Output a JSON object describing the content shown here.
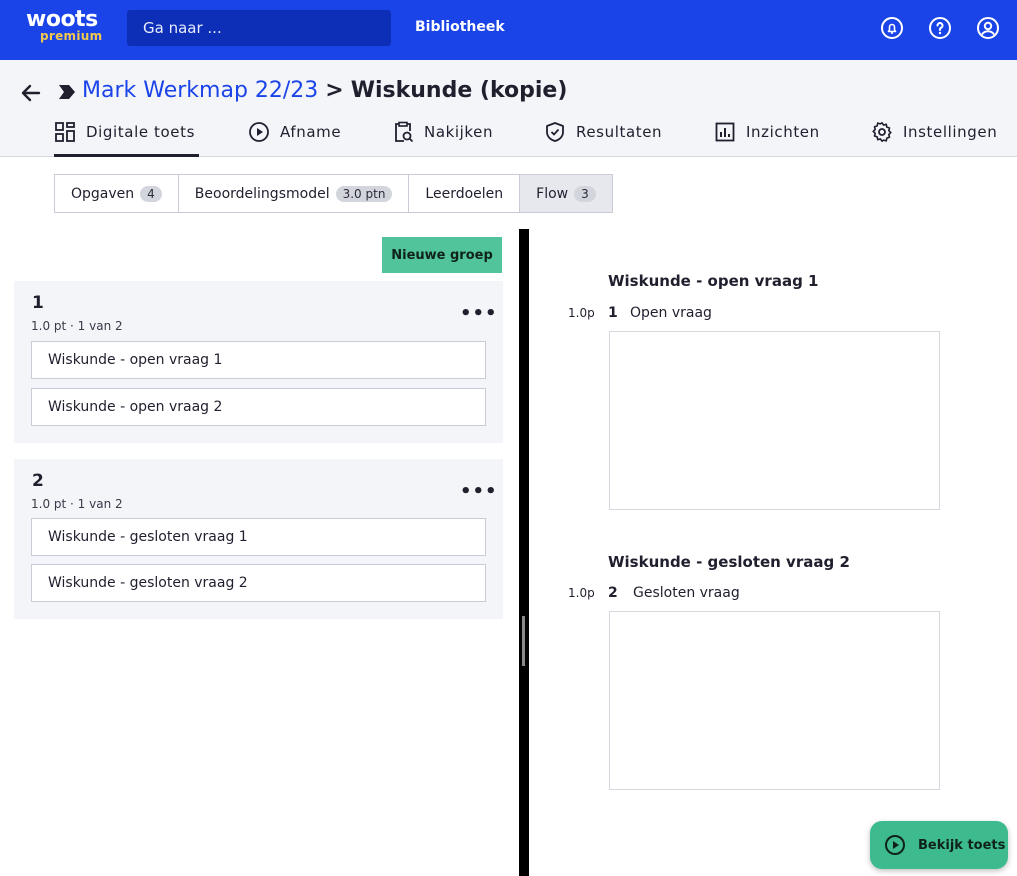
{
  "topbar": {
    "logo_main": "woots",
    "logo_sub": "premium",
    "search_placeholder": "Ga naar ...",
    "library_label": "Bibliotheek",
    "icons": [
      "bell-icon",
      "help-icon",
      "account-icon"
    ]
  },
  "breadcrumb": {
    "parent": "Mark Werkmap 22/23",
    "separator": ">",
    "current": "Wiskunde (kopie)"
  },
  "main_tabs": [
    {
      "label": "Digitale toets",
      "icon": "grid-icon",
      "active": true
    },
    {
      "label": "Afname",
      "icon": "play-icon",
      "active": false
    },
    {
      "label": "Nakijken",
      "icon": "clipboard-search-icon",
      "active": false
    },
    {
      "label": "Resultaten",
      "icon": "shield-check-icon",
      "active": false
    },
    {
      "label": "Inzichten",
      "icon": "bar-chart-icon",
      "active": false
    },
    {
      "label": "Instellingen",
      "icon": "gear-icon",
      "active": false
    }
  ],
  "sub_tabs": [
    {
      "label": "Opgaven",
      "badge": "4",
      "selected": false
    },
    {
      "label": "Beoordelingsmodel",
      "badge": "3.0 ptn",
      "selected": false
    },
    {
      "label": "Leerdoelen",
      "badge": "",
      "selected": false
    },
    {
      "label": "Flow",
      "badge": "3",
      "selected": true
    }
  ],
  "left": {
    "new_group_label": "Nieuwe groep",
    "groups": [
      {
        "number": "1",
        "meta": "1.0 pt  ·  1 van 2",
        "items": [
          "Wiskunde - open vraag 1",
          "Wiskunde - open vraag 2"
        ]
      },
      {
        "number": "2",
        "meta": "1.0 pt  ·  1 van 2",
        "items": [
          "Wiskunde - gesloten vraag 1",
          "Wiskunde - gesloten vraag 2"
        ]
      }
    ]
  },
  "preview": {
    "questions": [
      {
        "title": "Wiskunde - open vraag 1",
        "points": "1.0p",
        "number": "1",
        "type": "Open vraag"
      },
      {
        "title": "Wiskunde - gesloten vraag 2",
        "points": "1.0p",
        "number": "2",
        "type": "Gesloten vraag"
      }
    ]
  },
  "fab": {
    "label": "Bekijk toets"
  },
  "colors": {
    "brand_blue": "#1a44e8",
    "accent_green": "#52c49c",
    "logo_yellow": "#f2c94c"
  }
}
